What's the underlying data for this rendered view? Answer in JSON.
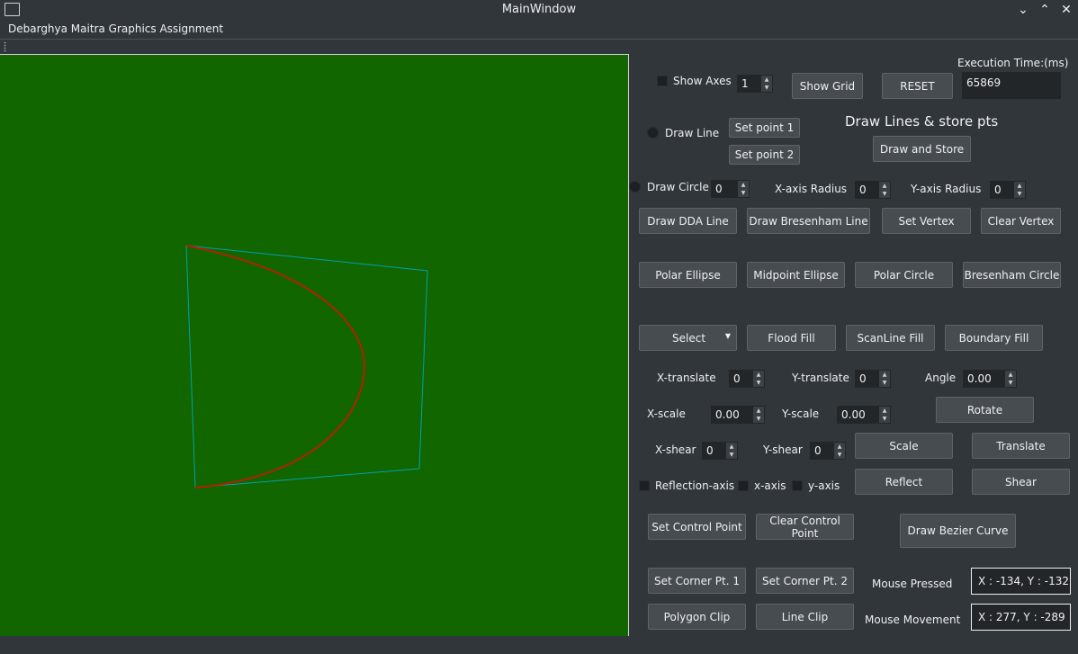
{
  "window": {
    "title": "MainWindow"
  },
  "menubar": {
    "item": "Debarghya Maitra Graphics Assignment"
  },
  "execution": {
    "label": "Execution Time:(ms)",
    "value": "65869"
  },
  "axes": {
    "show_label": "Show Axes",
    "value": "1"
  },
  "buttons": {
    "show_grid": "Show Grid",
    "reset": "RESET",
    "set_point_1": "Set point 1",
    "set_point_2": "Set point 2",
    "draw_and_store": "Draw and Store",
    "draw_dda": "Draw DDA Line",
    "draw_bresenham": "Draw Bresenham Line",
    "set_vertex": "Set Vertex",
    "clear_vertex": "Clear Vertex",
    "polar_ellipse": "Polar Ellipse",
    "midpoint_ellipse": "Midpoint Ellipse",
    "polar_circle": "Polar Circle",
    "bresenham_circle": "Bresenham Circle",
    "flood_fill": "Flood Fill",
    "scanline_fill": "ScanLine Fill",
    "boundary_fill": "Boundary Fill",
    "rotate": "Rotate",
    "scale": "Scale",
    "translate": "Translate",
    "reflect": "Reflect",
    "shear": "Shear",
    "set_control_point": "Set Control Point",
    "clear_control_point": "Clear Control Point",
    "draw_bezier": "Draw Bezier Curve",
    "set_corner_1": "Set Corner Pt. 1",
    "set_corner_2": "Set Corner Pt. 2",
    "polygon_clip": "Polygon Clip",
    "line_clip": "Line Clip"
  },
  "draw_line": {
    "label": "Draw Line",
    "heading": "Draw Lines & store pts"
  },
  "circle": {
    "label": "Draw Circle",
    "value": "0",
    "x_radius_label": "X-axis Radius",
    "x_radius": "0",
    "y_radius_label": "Y-axis Radius",
    "y_radius": "0"
  },
  "fill": {
    "select": "Select"
  },
  "transform": {
    "x_translate_label": "X-translate",
    "x_translate": "0",
    "y_translate_label": "Y-translate",
    "y_translate": "0",
    "angle_label": "Angle",
    "angle": "0.00",
    "x_scale_label": "X-scale",
    "x_scale": "0.00",
    "y_scale_label": "Y-scale",
    "y_scale": "0.00",
    "x_shear_label": "X-shear",
    "x_shear": "0",
    "y_shear_label": "Y-shear",
    "y_shear": "0"
  },
  "reflection": {
    "label": "Reflection-axis",
    "x_axis": "x-axis",
    "y_axis": "y-axis"
  },
  "mouse": {
    "pressed_label": "Mouse Pressed",
    "pressed_value": "X : -134, Y : -132",
    "movement_label": "Mouse Movement",
    "movement_value": "X : 277, Y : -289"
  },
  "colors": {
    "canvas": "#116600",
    "curve": "#b22000",
    "polygon": "#00a0b0"
  }
}
